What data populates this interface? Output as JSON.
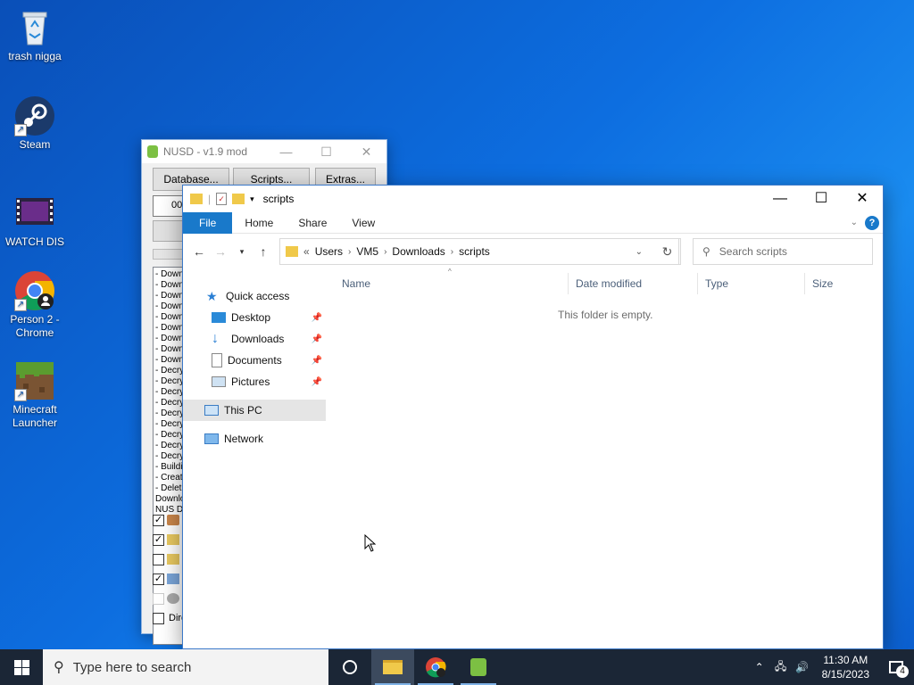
{
  "desktop": {
    "icons": [
      {
        "label": "trash nigga",
        "icon": "recycle-bin"
      },
      {
        "label": "Steam",
        "icon": "steam"
      },
      {
        "label": "WATCH DIS",
        "icon": "video-file"
      },
      {
        "label": "Person 2 - Chrome",
        "icon": "chrome"
      },
      {
        "label": "Minecraft Launcher",
        "icon": "minecraft"
      }
    ]
  },
  "nusd": {
    "title": "NUSD - v1.9 mod",
    "buttons": [
      "Database...",
      "Scripts...",
      "Extras..."
    ],
    "title_id_partial": "00",
    "log_lines": [
      "- Down",
      "- Down",
      "- Down",
      "- Down",
      "- Down",
      "- Down",
      "- Down",
      "- Down",
      "- Down",
      "- Decry",
      "- Decry",
      "- Decry",
      "- Decry",
      "- Decry",
      "- Decry",
      "- Decry",
      "- Decry",
      "- Decry",
      "- Buildi",
      "- Creat",
      "- Delet",
      "Downlo",
      "NUS De"
    ],
    "checkbox_last_label": "Dire"
  },
  "explorer": {
    "title": "scripts",
    "ribbon_tabs": [
      "File",
      "Home",
      "Share",
      "View"
    ],
    "breadcrumbs": [
      "Users",
      "VM5",
      "Downloads",
      "scripts"
    ],
    "search_placeholder": "Search scripts",
    "nav": {
      "quick_access": "Quick access",
      "items": [
        "Desktop",
        "Downloads",
        "Documents",
        "Pictures"
      ],
      "this_pc": "This PC",
      "network": "Network"
    },
    "columns": [
      "Name",
      "Date modified",
      "Type",
      "Size"
    ],
    "empty_message": "This folder is empty."
  },
  "taskbar": {
    "search_placeholder": "Type here to search",
    "time": "11:30 AM",
    "date": "8/15/2023",
    "notification_count": "4"
  },
  "colors": {
    "accent": "#1979ca",
    "taskbar": "#1b2636",
    "desktop": "#0d6ee0"
  }
}
